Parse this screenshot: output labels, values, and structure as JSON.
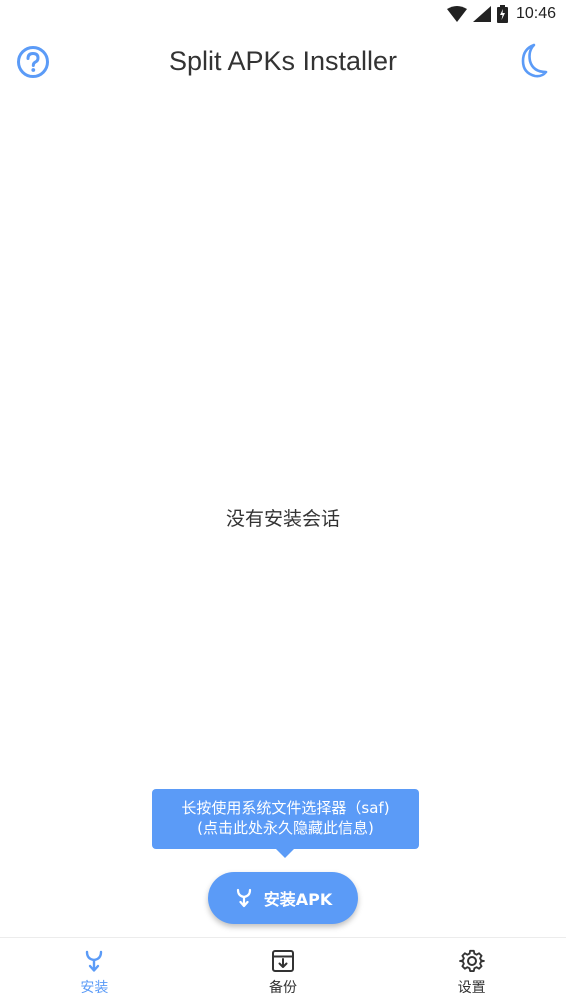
{
  "status_bar": {
    "time": "10:46"
  },
  "app_bar": {
    "title": "Split APKs Installer",
    "help_icon": "help-circle-icon",
    "theme_icon": "moon-icon"
  },
  "main": {
    "empty_text": "没有安装会话"
  },
  "tooltip": {
    "line1": "长按使用系统文件选择器（saf)",
    "line2": "(点击此处永久隐藏此信息)"
  },
  "fab": {
    "label": "安装APK",
    "icon": "install-fork-icon"
  },
  "bottom_nav": {
    "items": [
      {
        "label": "安装",
        "icon": "install-fork-icon",
        "active": true
      },
      {
        "label": "备份",
        "icon": "archive-icon",
        "active": false
      },
      {
        "label": "设置",
        "icon": "gear-icon",
        "active": false
      }
    ]
  },
  "colors": {
    "accent": "#5b9bf7",
    "text": "#333333",
    "background": "#ffffff"
  }
}
